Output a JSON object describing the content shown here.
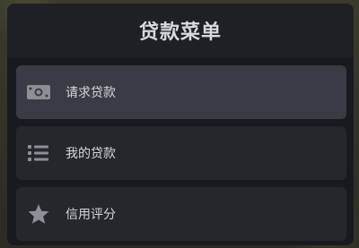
{
  "menu": {
    "title": "贷款菜单",
    "items": [
      {
        "label": "请求贷款",
        "icon": "money-bill-icon",
        "active": true
      },
      {
        "label": "我的贷款",
        "icon": "list-icon",
        "active": false
      },
      {
        "label": "信用评分",
        "icon": "star-icon",
        "active": false
      }
    ]
  },
  "colors": {
    "panel": "#191a1f",
    "header": "#1f2026",
    "item": "#26272d",
    "item_active": "#3a3b44",
    "text": "#d6d7dc",
    "icon": "#8e8f96"
  }
}
